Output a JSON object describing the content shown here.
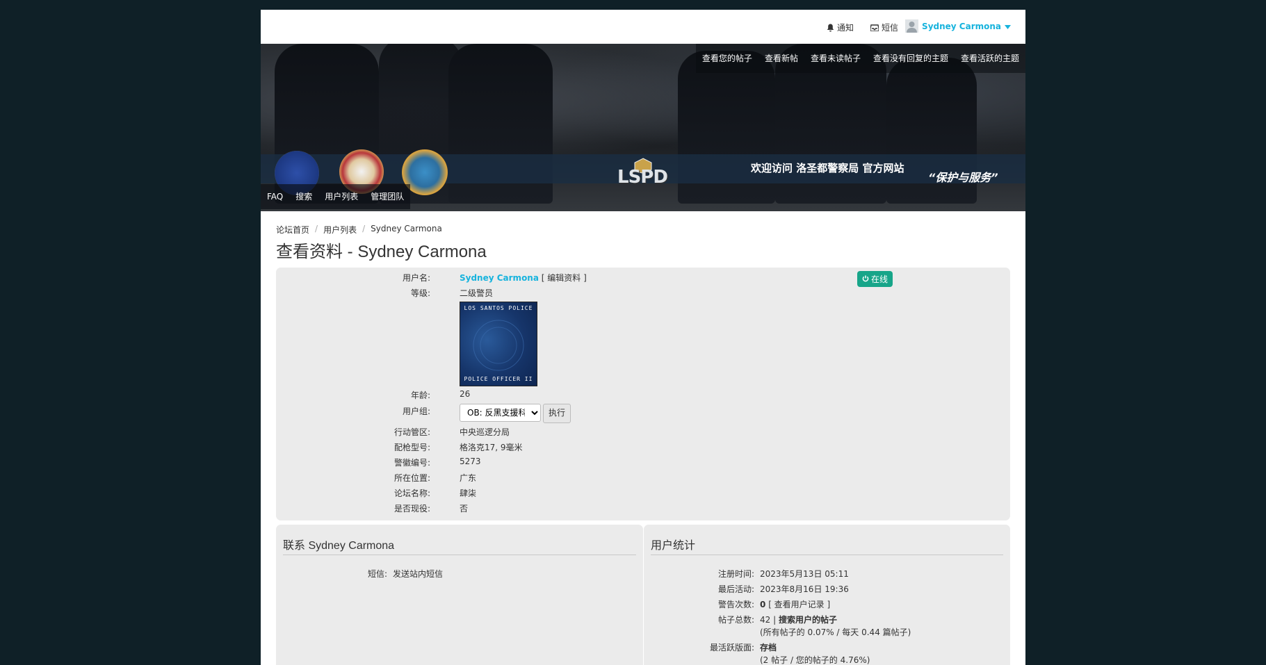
{
  "topbar": {
    "notifications_label": "通知",
    "messages_label": "短信",
    "username": "Sydney Carmona"
  },
  "quicknav": [
    "查看您的帖子",
    "查看新帖",
    "查看未读帖子",
    "查看没有回复的主题",
    "查看活跃的主题"
  ],
  "banner": {
    "welcome": "欢迎访问 洛圣都警察局 官方网站",
    "motto": "“保护与服务”",
    "logo_text": "LSPD"
  },
  "mainnav": [
    "FAQ",
    "搜索",
    "用户列表",
    "管理团队"
  ],
  "breadcrumb": [
    "论坛首页",
    "用户列表",
    "Sydney Carmona"
  ],
  "page_title": "查看资料 - Sydney Carmona",
  "profile": {
    "username_label": "用户名:",
    "username": "Sydney Carmona",
    "edit_link": "[ 编辑资料 ]",
    "online_badge": "在线",
    "rank_label": "等级:",
    "rank": "二级警员",
    "rank_image_top": "LOS SANTOS POLICE",
    "rank_image_bottom": "POLICE OFFICER II",
    "age_label": "年龄:",
    "age": "26",
    "group_label": "用户组:",
    "group_selected": "OB: 反黑支援科",
    "group_button": "执行",
    "fields": [
      {
        "label": "行动管区:",
        "value": "中央巡逻分局"
      },
      {
        "label": "配枪型号:",
        "value": "格洛克17, 9毫米"
      },
      {
        "label": "警徽编号:",
        "value": "5273"
      },
      {
        "label": "所在位置:",
        "value": "广东"
      },
      {
        "label": "论坛名称:",
        "value": "肆柒"
      },
      {
        "label": "是否现役:",
        "value": "否"
      }
    ]
  },
  "contact": {
    "title": "联系 Sydney Carmona",
    "pm_label": "短信:",
    "pm_link": "发送站内短信"
  },
  "stats": {
    "title": "用户统计",
    "joined_label": "注册时间:",
    "joined": "2023年5月13日 05:11",
    "last_active_label": "最后活动:",
    "last_active": "2023年8月16日 19:36",
    "warnings_label": "警告次数:",
    "warnings": "0",
    "warnings_link": "[ 查看用户记录 ]",
    "posts_label": "帖子总数:",
    "posts": "42",
    "posts_sep": "|",
    "posts_link": "搜索用户的帖子",
    "posts_detail": "(所有帖子的 0.07% / 每天 0.44 篇帖子)",
    "active_forum_label": "最活跃版面:",
    "active_forum": "存档",
    "active_forum_detail": "(2 帖子 / 您的帖子的 4.76%)"
  }
}
